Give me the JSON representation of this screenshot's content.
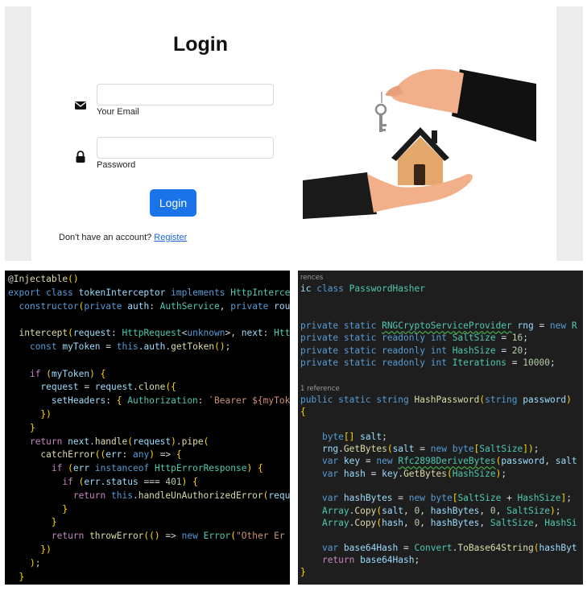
{
  "login": {
    "title": "Login",
    "email_label": "Your Email",
    "password_label": "Password",
    "button_label": "Login",
    "signup_text": "Don't have an account? ",
    "register_link": "Register",
    "icons": [
      "envelope-icon",
      "lock-icon"
    ],
    "accent_color": "#1a73e8"
  },
  "ts_code": {
    "lines": [
      "@Injectable()",
      "export class tokenInterceptor implements HttpInterce",
      "  constructor(private auth: AuthService, private rou",
      "",
      "  intercept(request: HttpRequest<unknown>, next: Htt",
      "    const myToken = this.auth.getToken();",
      "",
      "    if (myToken) {",
      "      request = request.clone({",
      "        setHeaders: { Authorization: `Bearer ${myTok",
      "      })",
      "    }",
      "    return next.handle(request).pipe(",
      "      catchError((err: any) => {",
      "        if (err instanceof HttpErrorResponse) {",
      "          if (err.status === 401) {",
      "            return this.handleUnAuthorizedError(requ",
      "          }",
      "        }",
      "        return throwError(() => new Error(\"Other Er",
      "      })",
      "    );",
      "  }"
    ]
  },
  "cs_code": {
    "lines": [
      "rences",
      "ic class PasswordHasher",
      "",
      "",
      "private static RNGCryptoServiceProvider rng = new R",
      "private static readonly int SaltSize = 16;",
      "private static readonly int HashSize = 20;",
      "private static readonly int Iterations = 10000;",
      "",
      "1 reference",
      "public static string HashPassword(string password)",
      "{",
      "",
      "    byte[] salt;",
      "    rng.GetBytes(salt = new byte[SaltSize]);",
      "    var key = new Rfc2898DeriveBytes(password, salt",
      "    var hash = key.GetBytes(HashSize);",
      "",
      "    var hashBytes = new byte[SaltSize + HashSize];",
      "    Array.Copy(salt, 0, hashBytes, 0, SaltSize);",
      "    Array.Copy(hash, 0, hashBytes, SaltSize, HashSi",
      "",
      "    var base64Hash = Convert.ToBase64String(hashByt",
      "    return base64Hash;",
      "}"
    ]
  }
}
